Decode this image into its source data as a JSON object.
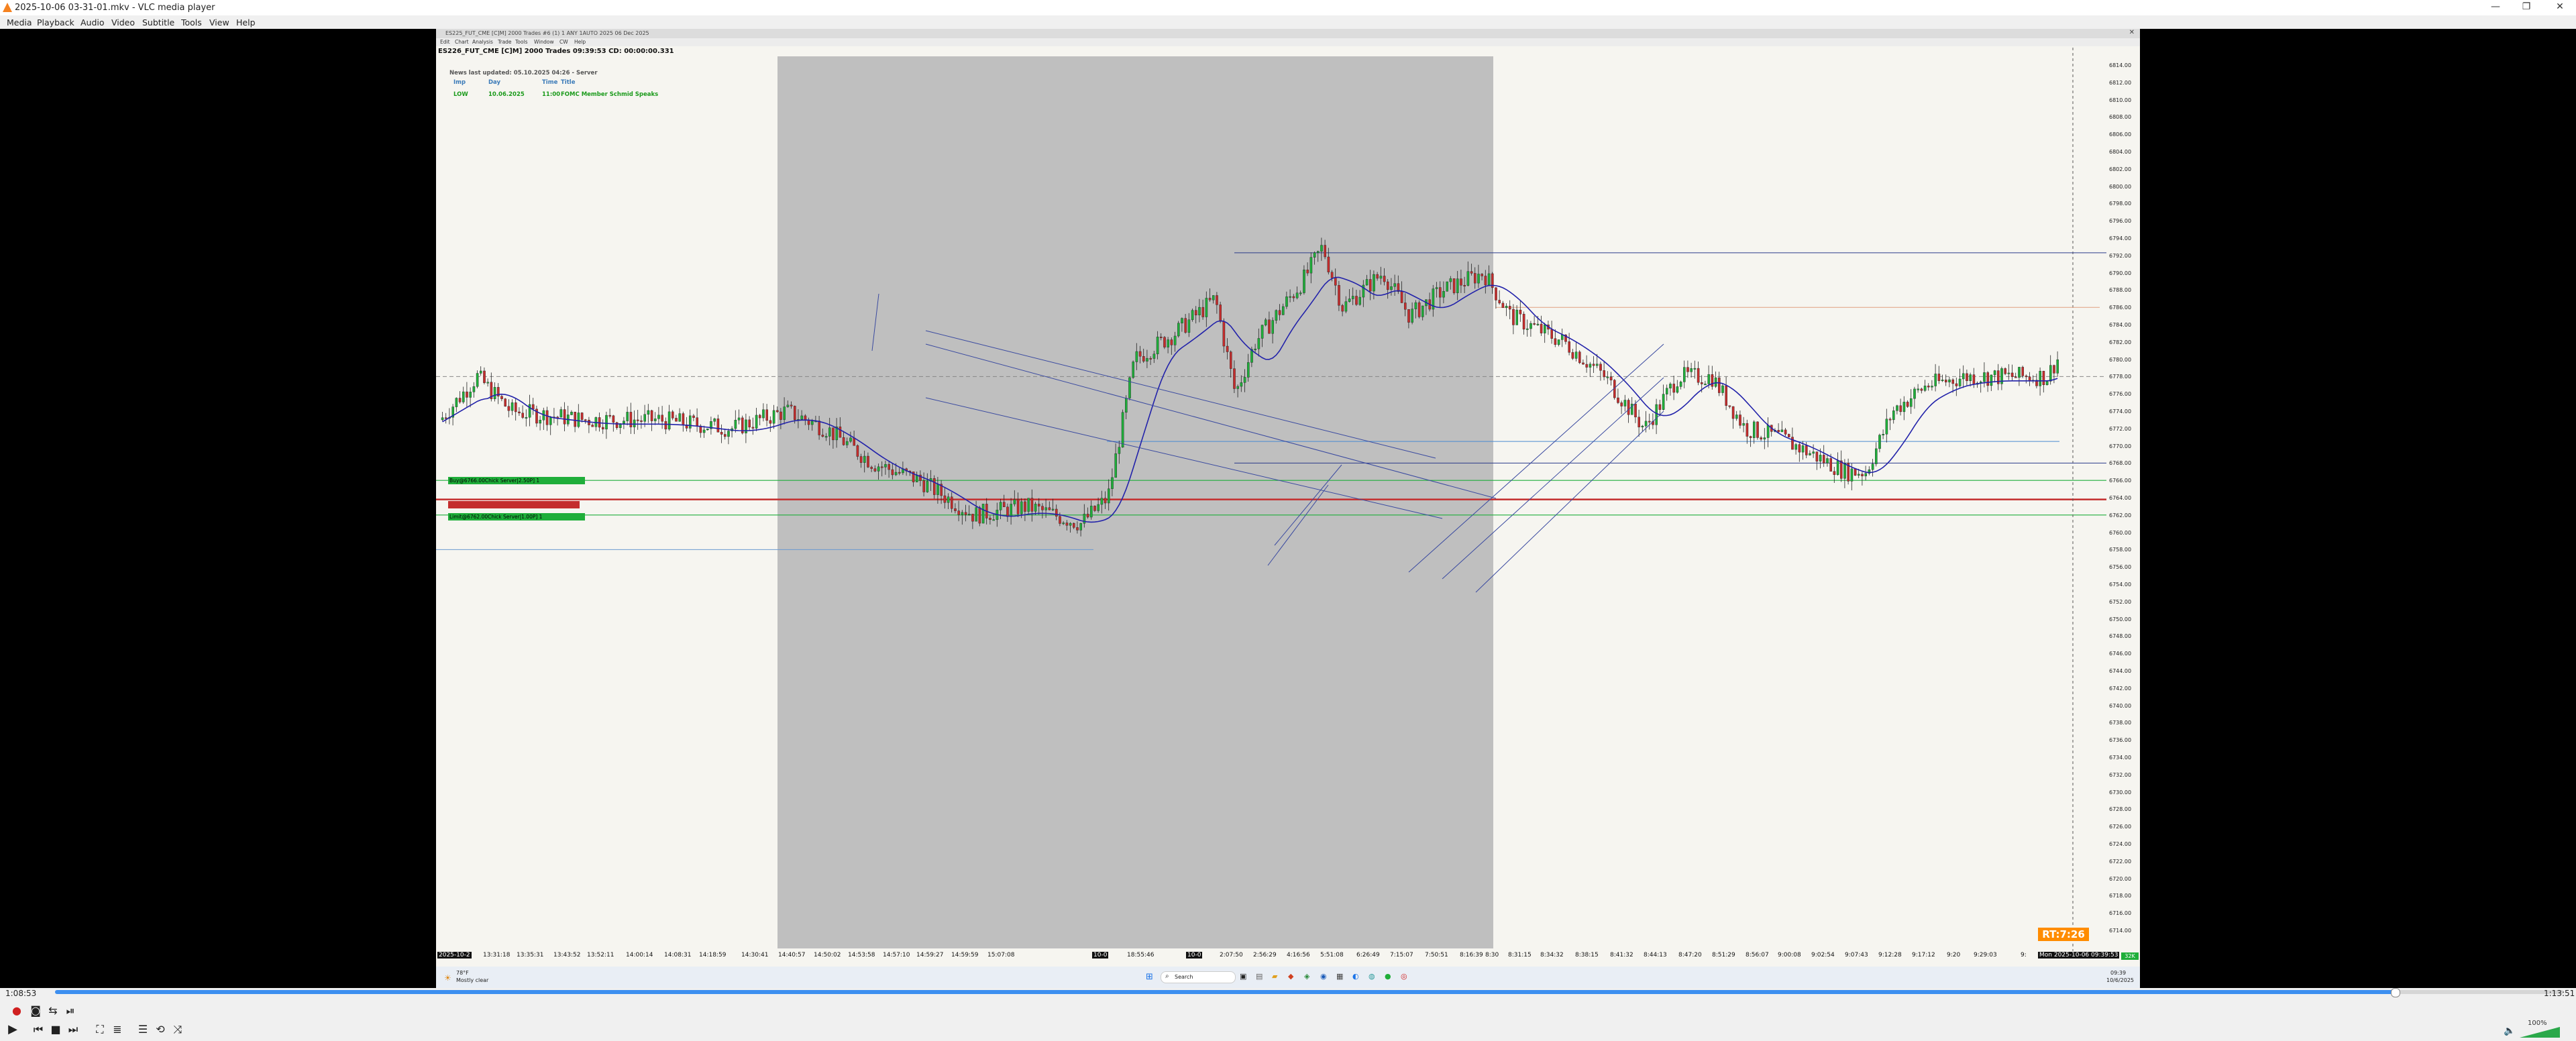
{
  "window": {
    "title": "2025-10-06 03-31-01.mkv - VLC media player",
    "minimize": "—",
    "maximize": "❐",
    "close": "✕"
  },
  "menu": [
    "Media",
    "Playback",
    "Audio",
    "Video",
    "Subtitle",
    "Tools",
    "View",
    "Help"
  ],
  "remote": {
    "window_title": "ES225_FUT_CME [C]M] 2000 Trades #6 (1) 1 ANY 1AUTO 2025 06 Dec 2025",
    "menu": [
      "Edit",
      "Chart",
      "Analysis",
      "Trade",
      "Tools",
      "Window",
      "CW",
      "Help"
    ],
    "chart_title": "ES226_FUT_CME [C]M] 2000 Trades 09:39:53 CD: 00:00:00.331",
    "news": {
      "header": "News last updated: 05.10.2025 04:26 - Server",
      "cols": [
        "Imp",
        "Day",
        "Time",
        "Title"
      ],
      "row": [
        "LOW",
        "10.06.2025",
        "11:00",
        "FOMC Member Schmid Speaks"
      ]
    },
    "order_tags": {
      "buy": "Buy@6766.00Chick Server|2.50P] 1",
      "sell": "",
      "limit": "Limit@6762.00Chick Server|1.00P] 1"
    },
    "price_labels": [
      "6814.00",
      "6812.00",
      "6810.00",
      "6808.00",
      "6806.00",
      "6804.00",
      "6802.00",
      "6800.00",
      "6798.00",
      "6796.00",
      "6794.00",
      "6792.00",
      "6790.00",
      "6788.00",
      "6786.00",
      "6784.00",
      "6782.00",
      "6780.00",
      "6778.00",
      "6776.00",
      "6774.00",
      "6772.00",
      "6770.00",
      "6768.00",
      "6766.00",
      "6764.00",
      "6762.00",
      "6760.00",
      "6758.00",
      "6756.00",
      "6754.00",
      "6752.00",
      "6750.00",
      "6748.00",
      "6746.00",
      "6744.00",
      "6742.00",
      "6740.00",
      "6738.00",
      "6736.00",
      "6734.00",
      "6732.00",
      "6730.00",
      "6728.00",
      "6726.00",
      "6724.00",
      "6722.00",
      "6720.00",
      "6718.00",
      "6716.00",
      "6714.00"
    ],
    "time_labels": [
      "2025-10-2",
      "13:31:18",
      "13:35:31",
      "13:43:52",
      "13:52:11",
      "14:00:14",
      "14:08:31",
      "14:18:59",
      "14:30:41",
      "14:40:57",
      "14:50:02",
      "14:53:58",
      "14:57:10",
      "14:59:27",
      "14:59:59",
      "15:07:08",
      "10-0",
      "18:55:46",
      "10-0",
      "2:07:50",
      "2:56:29",
      "4:16:56",
      "5:51:08",
      "6:26:49",
      "7:15:07",
      "7:50:51",
      "8:16:39",
      "8:30",
      "8:31:15",
      "8:34:32",
      "8:38:15",
      "8:41:32",
      "8:44:13",
      "8:47:20",
      "8:51:29",
      "8:56:07",
      "9:00:08",
      "9:02:54",
      "9:07:43",
      "9:12:28",
      "9:17:12",
      "9:20",
      "9:29:03",
      "9:",
      "Mon 2025-10-06 09:39:53"
    ],
    "rt_badge": "RT:7:26",
    "right_badge": "32K",
    "taskbar": {
      "weather_temp": "78°F",
      "weather_desc": "Mostly clear",
      "search": "Search",
      "clock_time": "09:39",
      "clock_date": "10/6/2025"
    }
  },
  "player": {
    "elapsed": "1:08:53",
    "total": "1:13:51",
    "progress": 0.9327,
    "volume": "100%"
  }
}
